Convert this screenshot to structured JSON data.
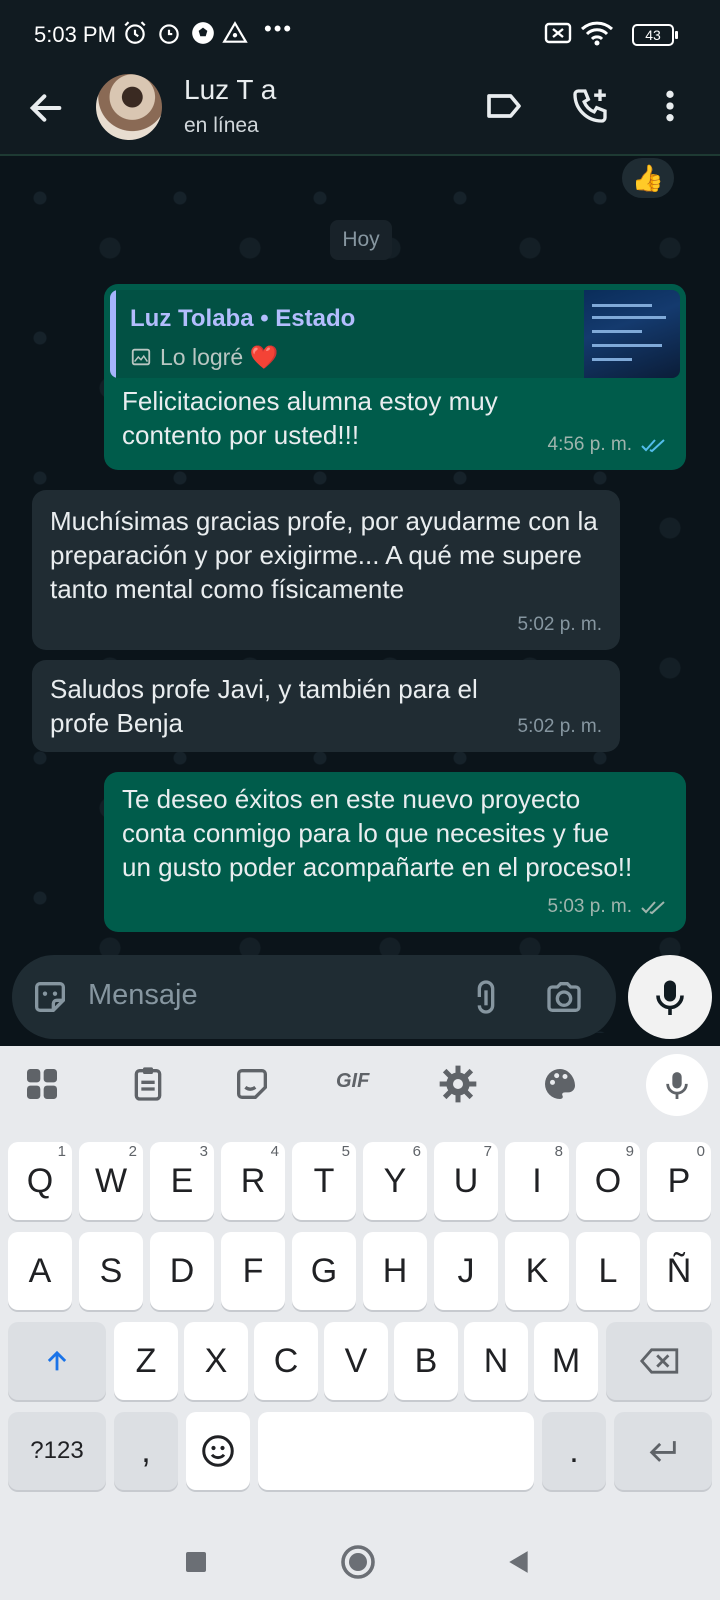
{
  "status_bar": {
    "time": "5:03 PM",
    "battery": "43"
  },
  "header": {
    "contact_name": "Luz T      a",
    "contact_status": "en línea"
  },
  "chat": {
    "reaction": "👍",
    "date_chip": "Hoy",
    "messages": [
      {
        "direction": "out",
        "quote": {
          "name": "Luz Tolaba • Estado",
          "text": "Lo logré ❤️"
        },
        "text": "Felicitaciones alumna estoy muy contento por usted!!!",
        "time": "4:56 p. m.",
        "read": true
      },
      {
        "direction": "in",
        "text": "Muchísimas gracias profe, por ayudarme con la preparación y por exigirme... A qué me supere tanto mental como físicamente",
        "time": "5:02 p. m."
      },
      {
        "direction": "in",
        "text": "Saludos profe Javi, y también para el profe Benja",
        "time": "5:02 p. m."
      },
      {
        "direction": "out",
        "text": "Te deseo éxitos en este nuevo proyecto conta conmigo para lo que necesites y fue un gusto poder acompañarte en el proceso!!",
        "time": "5:03 p. m.",
        "read": false
      }
    ]
  },
  "composer": {
    "placeholder": "Mensaje"
  },
  "keyboard": {
    "row1": [
      {
        "k": "Q",
        "n": "1"
      },
      {
        "k": "W",
        "n": "2"
      },
      {
        "k": "E",
        "n": "3"
      },
      {
        "k": "R",
        "n": "4"
      },
      {
        "k": "T",
        "n": "5"
      },
      {
        "k": "Y",
        "n": "6"
      },
      {
        "k": "U",
        "n": "7"
      },
      {
        "k": "I",
        "n": "8"
      },
      {
        "k": "O",
        "n": "9"
      },
      {
        "k": "P",
        "n": "0"
      }
    ],
    "row2": [
      "A",
      "S",
      "D",
      "F",
      "G",
      "H",
      "J",
      "K",
      "L",
      "Ñ"
    ],
    "row3": [
      "Z",
      "X",
      "C",
      "V",
      "B",
      "N",
      "M"
    ],
    "symbols_key": "?123",
    "comma_key": ",",
    "period_key": ".",
    "gif_label": "GIF"
  },
  "colors": {
    "outgoing": "#005c4b",
    "incoming": "#202c33",
    "background": "#0b141a",
    "read_ticks": "#53bdeb"
  }
}
